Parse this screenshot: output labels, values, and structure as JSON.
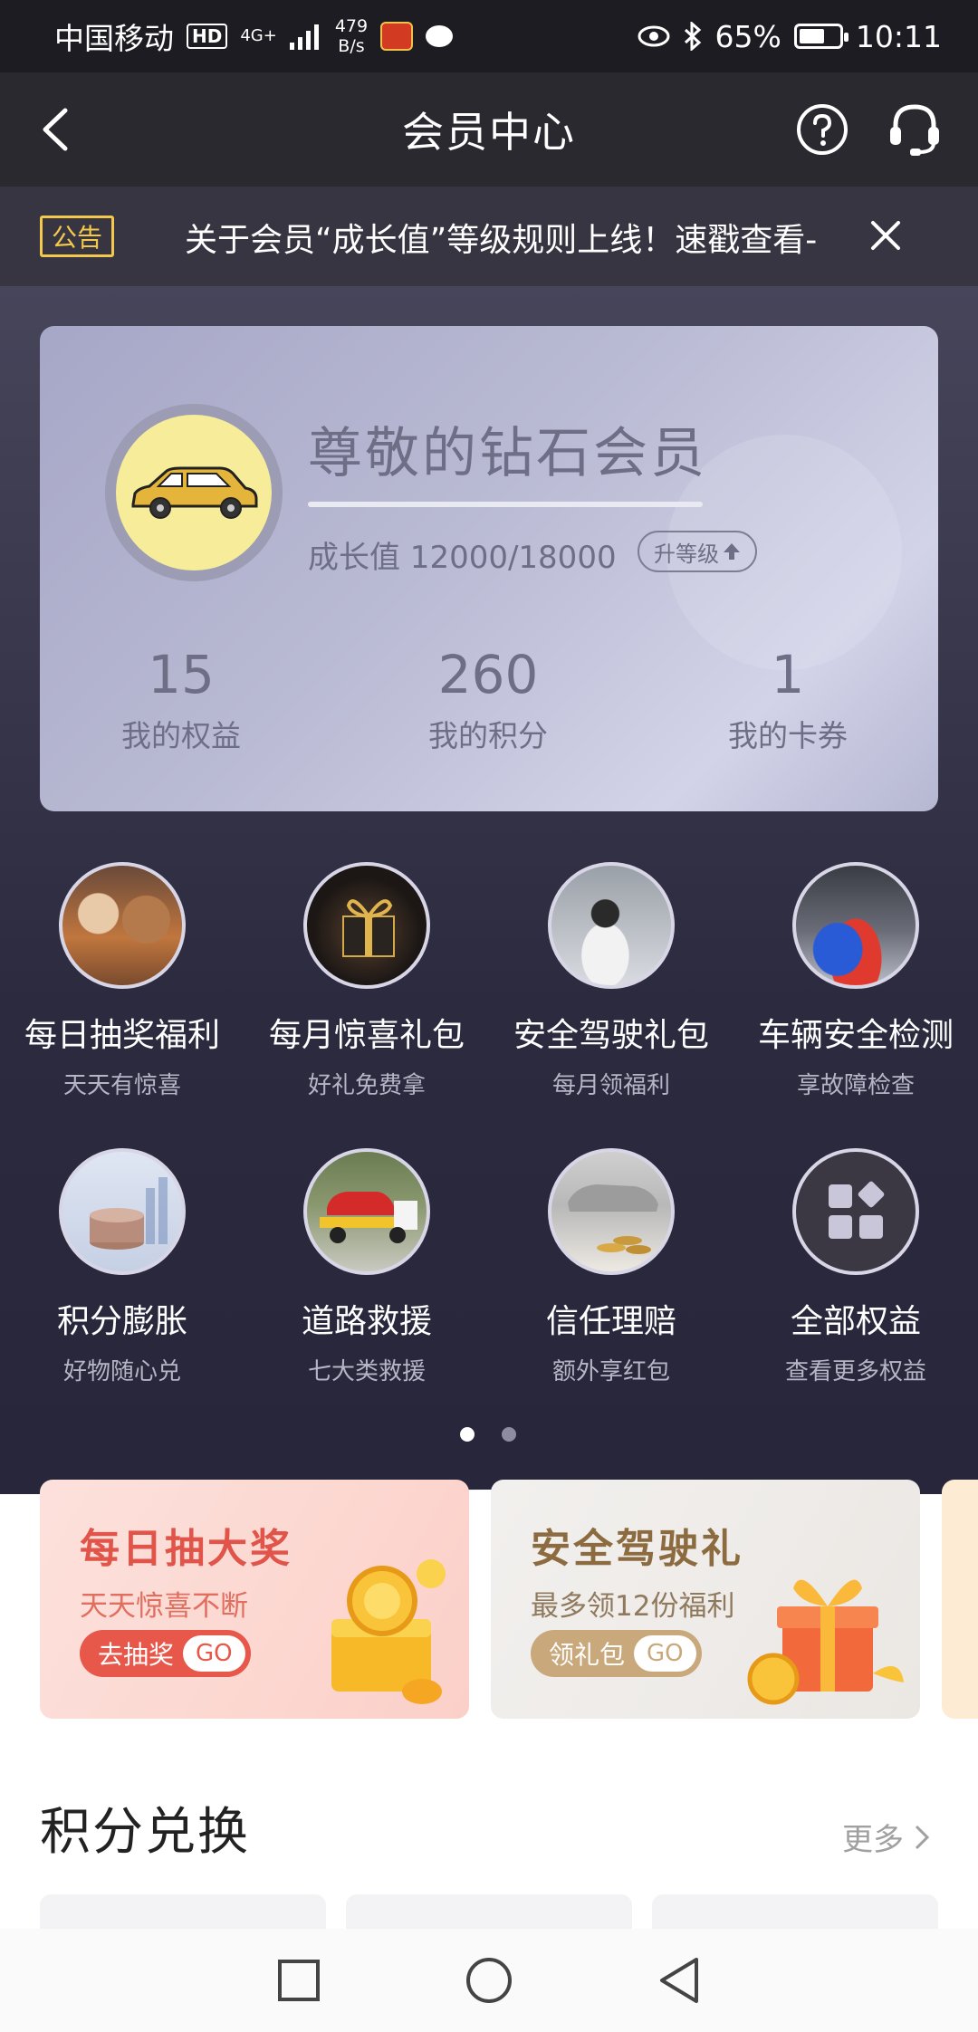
{
  "status_bar": {
    "carrier": "中国移动",
    "hd": "HD",
    "network": "4G+",
    "speed_value": "479",
    "speed_unit": "B/s",
    "battery": "65%",
    "battery_level": 0.65,
    "time": "10:11"
  },
  "header": {
    "title": "会员中心"
  },
  "notice": {
    "tag": "公告",
    "text": "关于会员“成长值”等级规则上线！速戳查看-"
  },
  "member": {
    "level": "尊敬的钻石会员",
    "growth_label": "成长值 12000/18000",
    "growth_progress": 0.6667,
    "upgrade_label": "升等级",
    "stats": [
      {
        "value": "15",
        "label": "我的权益"
      },
      {
        "value": "260",
        "label": "我的积分"
      },
      {
        "value": "1",
        "label": "我的卡券"
      }
    ]
  },
  "benefits": [
    {
      "title": "每日抽奖福利",
      "sub": "天天有惊喜",
      "icon": "people-photo-icon"
    },
    {
      "title": "每月惊喜礼包",
      "sub": "好礼免费拿",
      "icon": "gift-box-icon"
    },
    {
      "title": "安全驾驶礼包",
      "sub": "每月领福利",
      "icon": "driver-photo-icon"
    },
    {
      "title": "车辆安全检测",
      "sub": "享故障检查",
      "icon": "car-inspection-icon"
    },
    {
      "title": "积分膨胀",
      "sub": "好物随心兑",
      "icon": "coins-icon"
    },
    {
      "title": "道路救援",
      "sub": "七大类救援",
      "icon": "tow-truck-icon"
    },
    {
      "title": "信任理赔",
      "sub": "额外享红包",
      "icon": "claim-icon"
    },
    {
      "title": "全部权益",
      "sub": "查看更多权益",
      "icon": "grid-icon"
    }
  ],
  "banners": [
    {
      "title": "每日抽大奖",
      "sub": "天天惊喜不断",
      "button": "去抽奖",
      "go": "GO"
    },
    {
      "title": "安全驾驶礼",
      "sub": "最多领12份福利",
      "button": "领礼包",
      "go": "GO"
    }
  ],
  "section": {
    "title": "积分兑换",
    "more": "更多"
  },
  "colors": {
    "accent_yellow": "#f3c84b",
    "card_text": "#6e6e86",
    "banner_red": "#e7574a",
    "banner_gold": "#c9a97c"
  }
}
